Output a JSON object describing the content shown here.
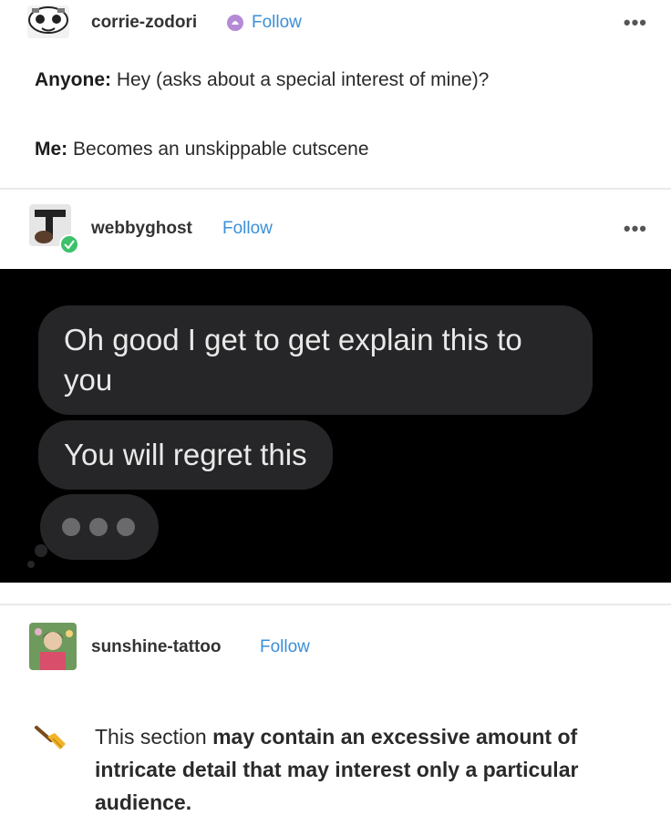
{
  "posts": [
    {
      "username": "corrie-zodori",
      "follow_label": "Follow",
      "more_label": "•••",
      "lines": [
        {
          "bold": "Anyone:",
          "text": " Hey (asks about a special interest of mine)?"
        },
        {
          "bold": "Me:",
          "text": " Becomes an unskippable cutscene"
        }
      ]
    },
    {
      "username": "webbyghost",
      "follow_label": "Follow",
      "more_label": "•••",
      "messages": [
        "Oh good I get to get explain this to you",
        "You will regret this"
      ]
    },
    {
      "username": "sunshine-tattoo",
      "follow_label": "Follow",
      "warning": {
        "intro": "This section ",
        "bold": "may contain an excessive amount of intricate detail that may interest only a particular audience."
      }
    }
  ]
}
